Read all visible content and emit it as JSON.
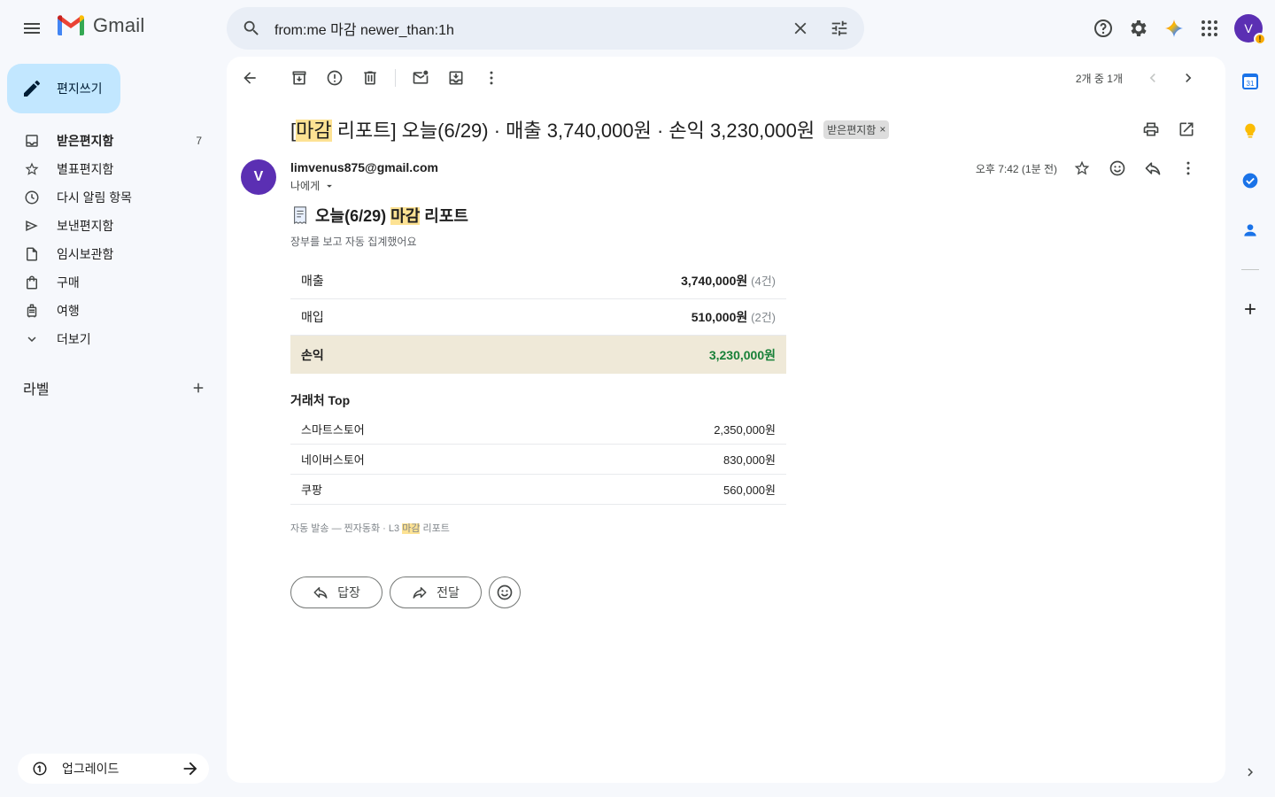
{
  "app": {
    "name": "Gmail"
  },
  "search": {
    "value": "from:me 마감 newer_than:1h"
  },
  "compose": {
    "label": "편지쓰기"
  },
  "sidebar": {
    "items": [
      {
        "label": "받은편지함",
        "count": "7",
        "icon": "inbox-icon"
      },
      {
        "label": "별표편지함",
        "count": "",
        "icon": "star-icon"
      },
      {
        "label": "다시 알림 항목",
        "count": "",
        "icon": "clock-icon"
      },
      {
        "label": "보낸편지함",
        "count": "",
        "icon": "send-icon"
      },
      {
        "label": "임시보관함",
        "count": "",
        "icon": "draft-icon"
      },
      {
        "label": "구매",
        "count": "",
        "icon": "bag-icon"
      },
      {
        "label": "여행",
        "count": "",
        "icon": "luggage-icon"
      },
      {
        "label": "더보기",
        "count": "",
        "icon": "chevron-down-icon"
      }
    ],
    "labels_heading": "라벨",
    "upgrade_label": "업그레이드"
  },
  "pager": {
    "text": "2개 중 1개"
  },
  "email": {
    "subject_prefix": "[",
    "subject_highlight": "마감",
    "subject_rest": " 리포트] 오늘(6/29) · 매출 3,740,000원 · 손익 3,230,000원",
    "label_chip": "받은편지함",
    "sender_initial": "V",
    "sender": "limvenus875@gmail.com",
    "to": "나에게",
    "time": "오후 7:42 (1분 전)",
    "report": {
      "title_pre": "오늘(6/29) ",
      "title_highlight": "마감",
      "title_post": " 리포트",
      "subtitle": "장부를 보고 자동 집계했어요",
      "summary": [
        {
          "label": "매출",
          "value": "3,740,000원",
          "count": "(4건)"
        },
        {
          "label": "매입",
          "value": "510,000원",
          "count": "(2건)"
        }
      ],
      "total": {
        "label": "손익",
        "value": "3,230,000원"
      },
      "top_title": "거래처 Top",
      "top": [
        {
          "name": "스마트스토어",
          "amount": "2,350,000원"
        },
        {
          "name": "네이버스토어",
          "amount": "830,000원"
        },
        {
          "name": "쿠팡",
          "amount": "560,000원"
        }
      ],
      "footer_pre": "자동 발송 — 찐자동화 · L3 ",
      "footer_highlight": "마감",
      "footer_post": " 리포트"
    }
  },
  "actions": {
    "reply": "답장",
    "forward": "전달"
  },
  "account": {
    "initial": "V",
    "warning": "!"
  },
  "calendar_day": "31",
  "colors": {
    "accent": "#c2e7ff",
    "avatar": "#5b2fb3",
    "profit": "#188038",
    "highlight": "#fde293",
    "total_row": "#efe9d8"
  }
}
